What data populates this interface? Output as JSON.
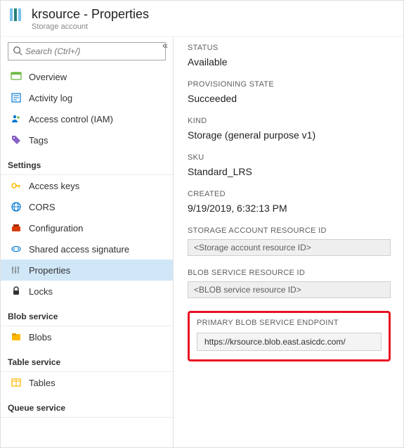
{
  "header": {
    "title": "krsource - Properties",
    "subtitle": "Storage account"
  },
  "search": {
    "placeholder": "Search (Ctrl+/)"
  },
  "nav": {
    "top": [
      {
        "key": "overview",
        "label": "Overview"
      },
      {
        "key": "activity-log",
        "label": "Activity log"
      },
      {
        "key": "access-control",
        "label": "Access control (IAM)"
      },
      {
        "key": "tags",
        "label": "Tags"
      }
    ],
    "groups": [
      {
        "title": "Settings",
        "items": [
          {
            "key": "access-keys",
            "label": "Access keys"
          },
          {
            "key": "cors",
            "label": "CORS"
          },
          {
            "key": "configuration",
            "label": "Configuration"
          },
          {
            "key": "sas",
            "label": "Shared access signature"
          },
          {
            "key": "properties",
            "label": "Properties",
            "selected": true
          },
          {
            "key": "locks",
            "label": "Locks"
          }
        ]
      },
      {
        "title": "Blob service",
        "items": [
          {
            "key": "blobs",
            "label": "Blobs"
          }
        ]
      },
      {
        "title": "Table service",
        "items": [
          {
            "key": "tables",
            "label": "Tables"
          }
        ]
      },
      {
        "title": "Queue service",
        "items": []
      }
    ]
  },
  "properties": {
    "status": {
      "label": "STATUS",
      "value": "Available"
    },
    "provisioning": {
      "label": "PROVISIONING STATE",
      "value": "Succeeded"
    },
    "kind": {
      "label": "KIND",
      "value": "Storage (general purpose v1)"
    },
    "sku": {
      "label": "SKU",
      "value": "Standard_LRS"
    },
    "created": {
      "label": "CREATED",
      "value": "9/19/2019, 6:32:13 PM"
    },
    "resourceId": {
      "label": "STORAGE ACCOUNT RESOURCE ID",
      "value": "<Storage account resource ID>"
    },
    "blobResourceId": {
      "label": "BLOB SERVICE RESOURCE ID",
      "value": "<BLOB service resource ID>"
    },
    "blobEndpoint": {
      "label": "PRIMARY BLOB SERVICE ENDPOINT",
      "value": "https://krsource.blob.east.asicdc.com/"
    }
  },
  "icons": {
    "overview": "#0078d4",
    "activity": "#0078d4",
    "iam": "#0078d4",
    "tags": "#8661c5",
    "key": "#ffb900",
    "cors": "#0078d4",
    "config": "#d83b01",
    "sas": "#0078d4",
    "props": "#879092",
    "lock": "#323130",
    "blobs": "#ffb900",
    "tables": "#ffb900"
  }
}
